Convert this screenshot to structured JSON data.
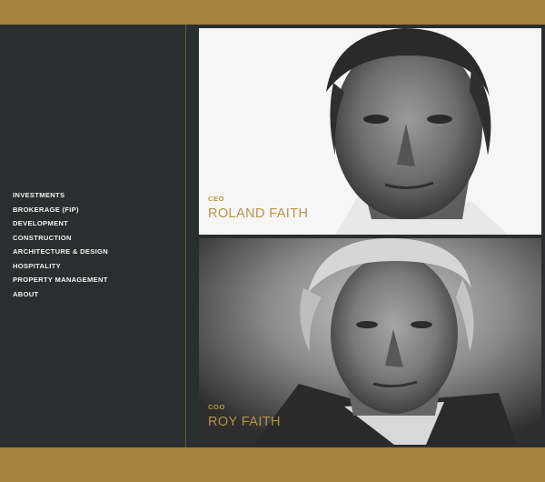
{
  "nav": {
    "items": [
      {
        "label": "INVESTMENTS"
      },
      {
        "label": "BROKERAGE (FIP)"
      },
      {
        "label": "DEVELOPMENT"
      },
      {
        "label": "CONSTRUCTION"
      },
      {
        "label": "ARCHITECTURE & DESIGN"
      },
      {
        "label": "HOSPITALITY"
      },
      {
        "label": "PROPERTY MANAGEMENT"
      },
      {
        "label": "ABOUT"
      }
    ]
  },
  "people": [
    {
      "role": "CEO",
      "name": "ROLAND FAITH"
    },
    {
      "role": "COO",
      "name": "ROY FAITH"
    }
  ],
  "colors": {
    "gold": "#a8823e",
    "caption_gold": "#b8934a",
    "sidebar": "#2a2e2e"
  }
}
